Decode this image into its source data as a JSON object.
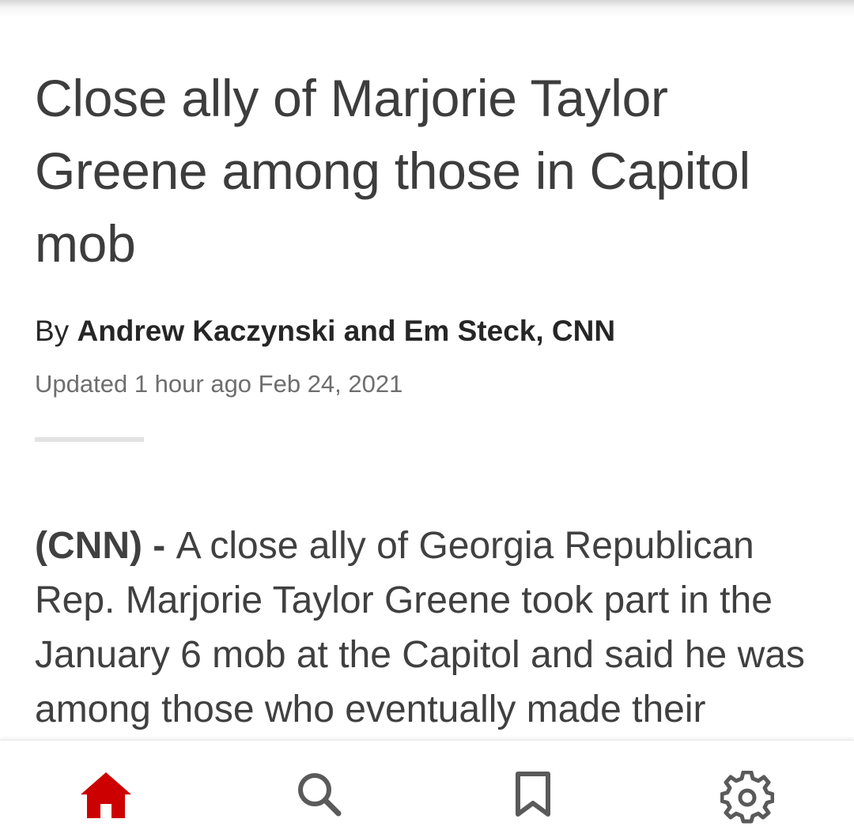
{
  "article": {
    "headline": "Close ally of Marjorie Taylor Greene among those in Capitol mob",
    "byline_prefix": "By ",
    "authors": "Andrew Kaczynski and Em Steck, CNN",
    "timestamp": "Updated 1 hour ago Feb 24, 2021",
    "body_source": "(CNN)",
    "body_dash": " - ",
    "body_text": "A close ally of Georgia Republican Rep. Marjorie Taylor Greene took part in the January 6 mob at the Capitol and said he was among those who eventually made their"
  },
  "bottom_nav": {
    "active_color": "#cc0000",
    "inactive_color": "#5a5a5a",
    "items": [
      {
        "icon": "home-icon",
        "active": true
      },
      {
        "icon": "search-icon",
        "active": false
      },
      {
        "icon": "bookmark-icon",
        "active": false
      },
      {
        "icon": "gear-icon",
        "active": false
      }
    ]
  }
}
